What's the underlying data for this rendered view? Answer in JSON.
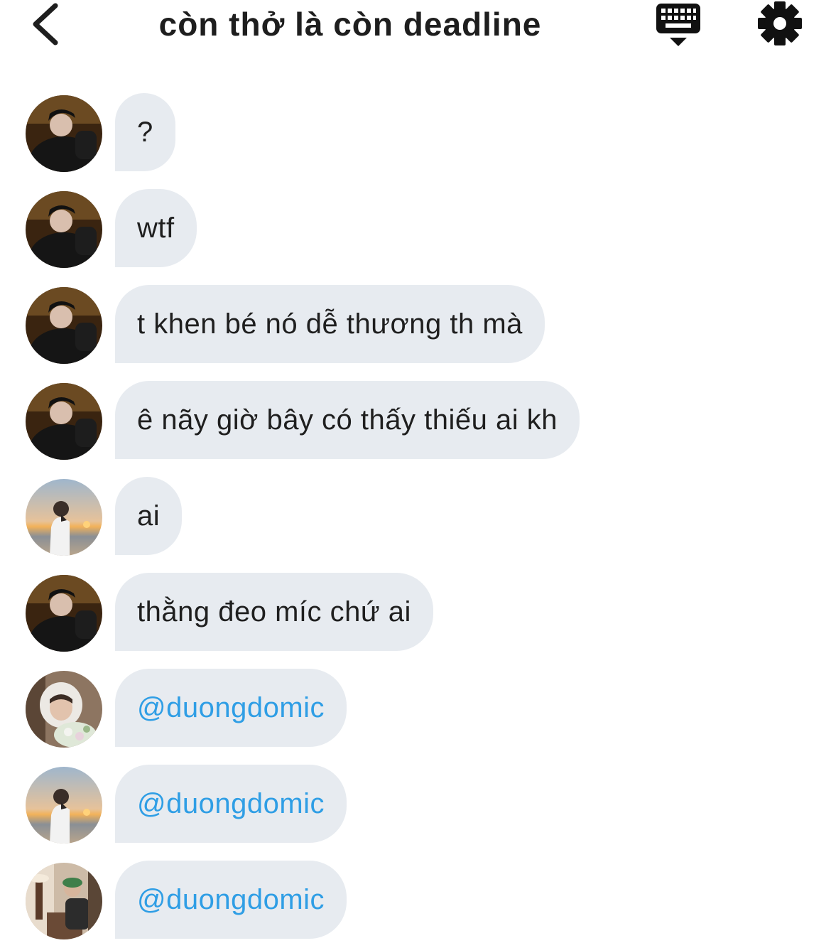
{
  "header": {
    "title": "còn thở là còn deadline"
  },
  "messages": [
    {
      "avatar": "avatar-dark-jacket",
      "text": "?",
      "type": "text"
    },
    {
      "avatar": "avatar-dark-jacket",
      "text": "wtf",
      "type": "text"
    },
    {
      "avatar": "avatar-dark-jacket",
      "text": "t khen bé nó dễ thương th mà",
      "type": "text"
    },
    {
      "avatar": "avatar-dark-jacket",
      "text": "ê nãy giờ bây có thấy thiếu ai kh",
      "type": "text"
    },
    {
      "avatar": "avatar-sunset-beach",
      "text": "ai",
      "type": "text"
    },
    {
      "avatar": "avatar-dark-jacket",
      "text": "thằng đeo míc chứ ai",
      "type": "text"
    },
    {
      "avatar": "avatar-hood-flowers",
      "text": "@duongdomic",
      "type": "mention"
    },
    {
      "avatar": "avatar-sunset-beach",
      "text": "@duongdomic",
      "type": "mention"
    },
    {
      "avatar": "avatar-green-cap-room",
      "text": "@duongdomic",
      "type": "mention"
    }
  ],
  "colors": {
    "bubble": "#e7ebf0",
    "mention": "#2f9ee5",
    "text": "#1f1f1f"
  },
  "icons": [
    "back-chevron-icon",
    "keyboard-icon",
    "gear-icon"
  ]
}
